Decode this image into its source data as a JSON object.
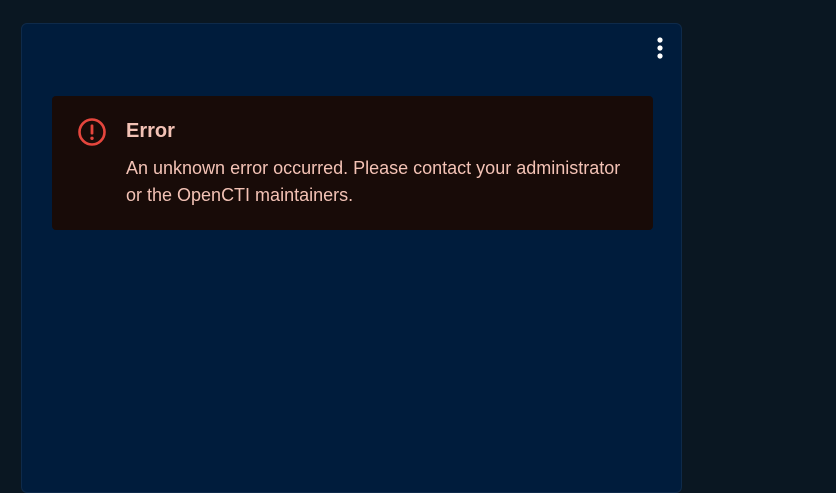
{
  "widget": {
    "menu_icon": "more-vert-icon",
    "alert": {
      "severity": "error",
      "icon": "error-outline-icon",
      "title": "Error",
      "message": "An unknown error occurred. Please contact your administrator or the OpenCTI maintainers."
    }
  },
  "colors": {
    "page_background": "#0a1722",
    "card_background": "#001c3c",
    "alert_background": "#180b08",
    "alert_icon": "#e5463d",
    "alert_text": "#f3c2b5",
    "menu_icon": "#ffffff"
  }
}
